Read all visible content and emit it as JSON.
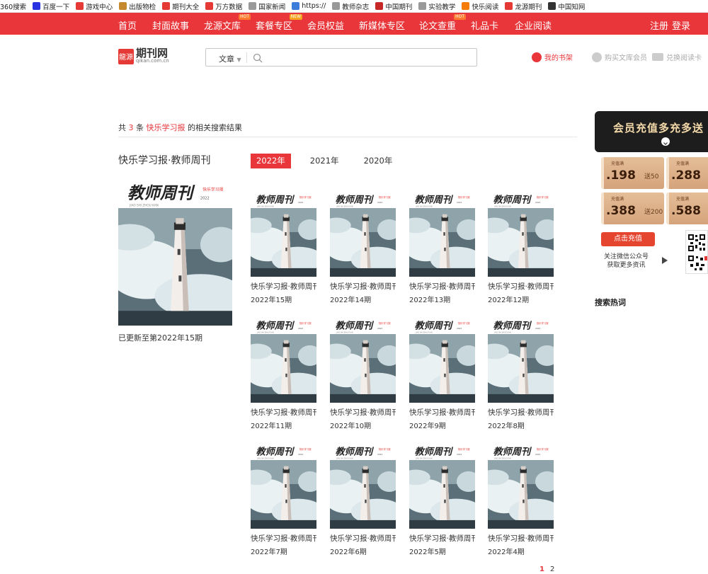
{
  "bookmarks": [
    {
      "label": "360搜索",
      "icon": "360-icon",
      "color": ""
    },
    {
      "label": "百度一下",
      "icon": "baidu-paw-icon",
      "color": "#2932e1"
    },
    {
      "label": "游戏中心",
      "icon": "game-icon",
      "color": "#e53935"
    },
    {
      "label": "出版物检",
      "icon": "publication-icon",
      "color": "#c68a2e"
    },
    {
      "label": "期刊大全",
      "icon": "journal-icon",
      "color": "#e53935"
    },
    {
      "label": "万方数据",
      "icon": "wanfang-icon",
      "color": "#e53935"
    },
    {
      "label": "国家新闻",
      "icon": "page-icon",
      "color": "#999999"
    },
    {
      "label": "https://",
      "icon": "globe-icon",
      "color": "#3b7dd8"
    },
    {
      "label": "教师杂志",
      "icon": "page-icon",
      "color": "#999999"
    },
    {
      "label": "中国期刊",
      "icon": "target-icon",
      "color": "#c62828"
    },
    {
      "label": "实验教学",
      "icon": "page-icon",
      "color": "#999999"
    },
    {
      "label": "快乐阅读",
      "icon": "happy-icon",
      "color": "#f57c00"
    },
    {
      "label": "龙源期刊",
      "icon": "longyuan-icon",
      "color": "#e53935"
    },
    {
      "label": "中国知网",
      "icon": "cnki-icon",
      "color": "#333333"
    }
  ],
  "nav": {
    "items": [
      {
        "label": "首页",
        "tag": ""
      },
      {
        "label": "封面故事",
        "tag": ""
      },
      {
        "label": "龙源文库",
        "tag": "HOT"
      },
      {
        "label": "套餐专区",
        "tag": "NEW"
      },
      {
        "label": "会员权益",
        "tag": ""
      },
      {
        "label": "新媒体专区",
        "tag": ""
      },
      {
        "label": "论文查重",
        "tag": "HOT"
      },
      {
        "label": "礼品卡",
        "tag": ""
      },
      {
        "label": "企业阅读",
        "tag": ""
      }
    ],
    "register": "注册",
    "login": "登录"
  },
  "logo": {
    "mark": "龍源",
    "name": "期刊网",
    "domain": "qikan.com.cn"
  },
  "search": {
    "category": "文章",
    "placeholder": ""
  },
  "tools": {
    "bookshelf": "我的书架",
    "buy_member": "购买文库会员",
    "redeem": "兑换阅读卡"
  },
  "colors": {
    "brand": "#e8363a"
  },
  "summary": {
    "prefix": "共",
    "count": "3",
    "unit": "条",
    "keyword": "快乐学习报",
    "suffix": "的相关搜索结果"
  },
  "magazine": {
    "title": "快乐学习报·教师周刊",
    "cover_title": "教师周刊",
    "cover_pinyin": "JIAO SHI ZHOU KAN",
    "cover_badge": "快乐学习报",
    "cover_year": "2022",
    "updated": "已更新至第2022年15期"
  },
  "years": [
    {
      "label": "2022年",
      "active": true
    },
    {
      "label": "2021年",
      "active": false
    },
    {
      "label": "2020年",
      "active": false
    }
  ],
  "issues": [
    {
      "title": "快乐学习报·教师周刊",
      "issue": "2022年15期"
    },
    {
      "title": "快乐学习报·教师周刊",
      "issue": "2022年14期"
    },
    {
      "title": "快乐学习报·教师周刊",
      "issue": "2022年13期"
    },
    {
      "title": "快乐学习报·教师周刊",
      "issue": "2022年12期"
    },
    {
      "title": "快乐学习报·教师周刊",
      "issue": "2022年11期"
    },
    {
      "title": "快乐学习报·教师周刊",
      "issue": "2022年10期"
    },
    {
      "title": "快乐学习报·教师周刊",
      "issue": "2022年9期"
    },
    {
      "title": "快乐学习报·教师周刊",
      "issue": "2022年8期"
    },
    {
      "title": "快乐学习报·教师周刊",
      "issue": "2022年7期"
    },
    {
      "title": "快乐学习报·教师周刊",
      "issue": "2022年6期"
    },
    {
      "title": "快乐学习报·教师周刊",
      "issue": "2022年5期"
    },
    {
      "title": "快乐学习报·教师周刊",
      "issue": "2022年4期"
    }
  ],
  "pager": {
    "pages": [
      "1",
      "2"
    ],
    "current": "1"
  },
  "promo": {
    "heading": "会员充值多充多送",
    "coupons": [
      {
        "label": "充值满",
        "value": ".198",
        "gift": "送50"
      },
      {
        "label": "充值满",
        "value": ".288",
        "gift": "送"
      },
      {
        "label": "充值满",
        "value": ".388",
        "gift": "送200"
      },
      {
        "label": "充值满",
        "value": ".588",
        "gift": "送"
      }
    ],
    "button": "点击充值",
    "wechat_line1": "关注微信公众号",
    "wechat_line2": "获取更多资讯"
  },
  "hot_search": {
    "title": "搜索热词"
  }
}
